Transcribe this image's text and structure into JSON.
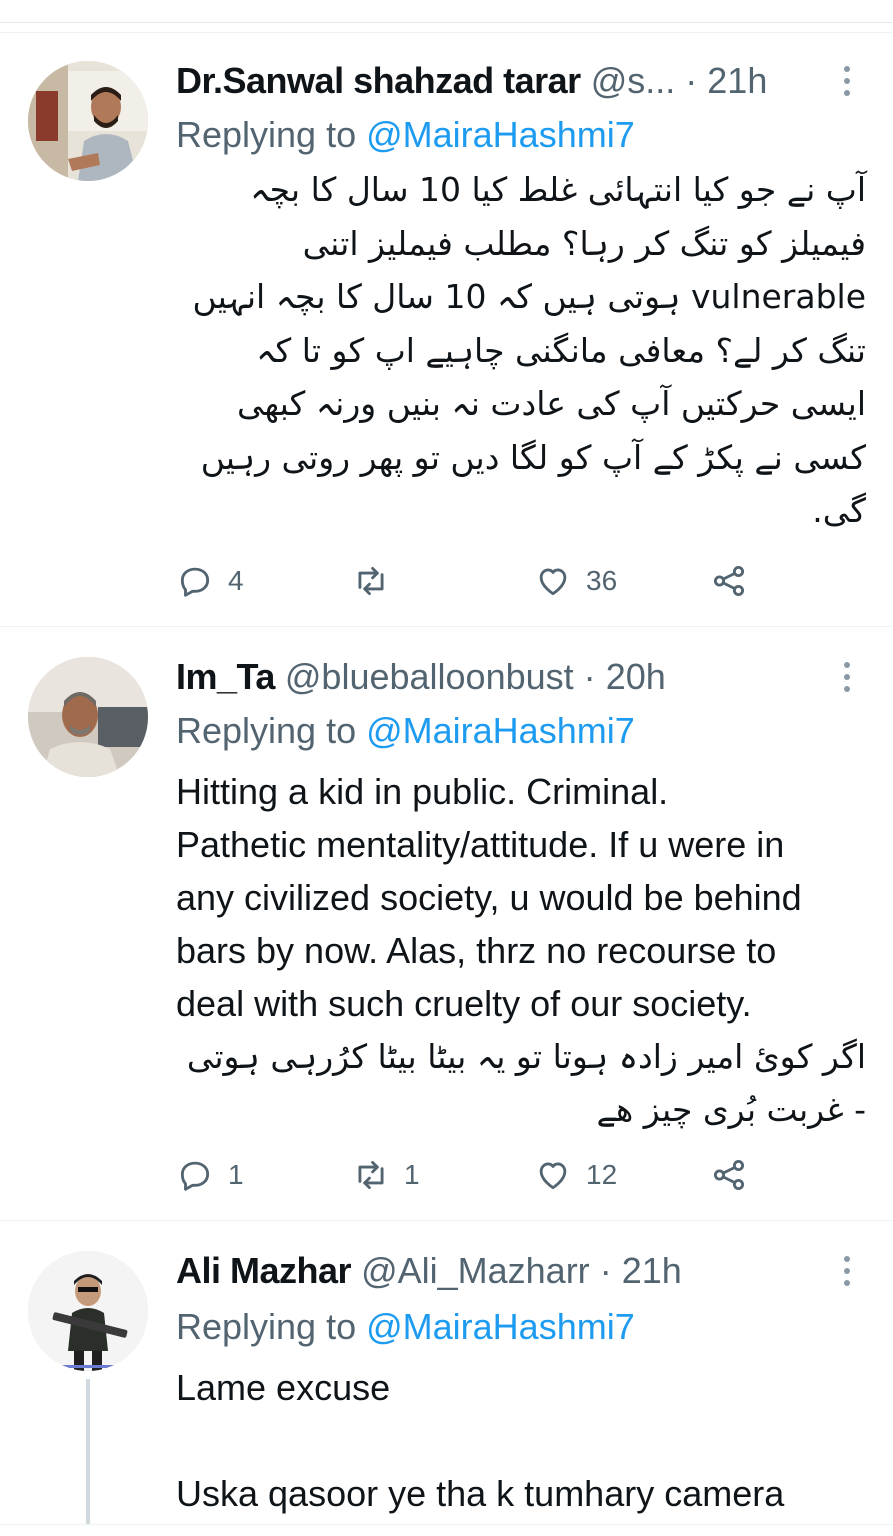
{
  "tweets": [
    {
      "name": "Dr.Sanwal shahzad tarar",
      "handle": "@s...",
      "separator": "·",
      "time": "21h",
      "replying_prefix": "Replying to ",
      "replying_to": "@MairaHashmi7",
      "body_lines": [
        "آپ نے جو کیا انتہائی غلط کیا  10 سال کا بچہ",
        "فیمیلز کو تنگ کر رہا؟ مطلب فیملیز اتنی",
        "vulnerable ہوتی ہیں کہ 10 سال کا بچہ انہیں",
        "تنگ کر لے؟  معافی مانگنی چاہیے اپ کو تا کہ",
        "ایسی حرکتیں آپ کی عادت نہ بنیں ورنہ کبھی",
        "کسی نے پکڑ کے آپ کو لگا دیں تو پھر روتی رہیں",
        "گی."
      ],
      "replies": "4",
      "retweets": "",
      "likes": "36",
      "avatar_icon": "profile-photo"
    },
    {
      "name": "Im_Ta",
      "handle": "@blueballoonbust",
      "separator": "·",
      "time": "20h",
      "replying_prefix": "Replying to ",
      "replying_to": "@MairaHashmi7",
      "body_lines": [
        "Hitting a kid in public. Criminal.",
        "Pathetic mentality/attitude. If u were in",
        "any civilized society, u would be behind",
        "bars by now.   Alas, thrz no recourse to",
        "deal with such cruelty of our society.",
        "اگر کوئ امیر زادہ ہوتا تو یہ بیٹا بیٹا کرُرہی ہوتی",
        "- غربت بُری چیز ھے"
      ],
      "replies": "1",
      "retweets": "1",
      "likes": "12",
      "avatar_icon": "profile-photo"
    },
    {
      "name": "Ali Mazhar",
      "handle": "@Ali_Mazharr",
      "separator": "·",
      "time": "21h",
      "replying_prefix": "Replying to ",
      "replying_to": "@MairaHashmi7",
      "body_lines": [
        "Lame excuse",
        "",
        "Uska qasoor ye tha k tumhary camera"
      ],
      "avatar_icon": "profile-photo"
    }
  ],
  "icons": {
    "reply": "reply-icon",
    "retweet": "retweet-icon",
    "like": "heart-icon",
    "share": "share-icon",
    "more": "more-options-icon"
  },
  "colors": {
    "text": "#0f1419",
    "muted": "#536471",
    "link": "#1d9bf0",
    "divider": "#eff3f4"
  }
}
